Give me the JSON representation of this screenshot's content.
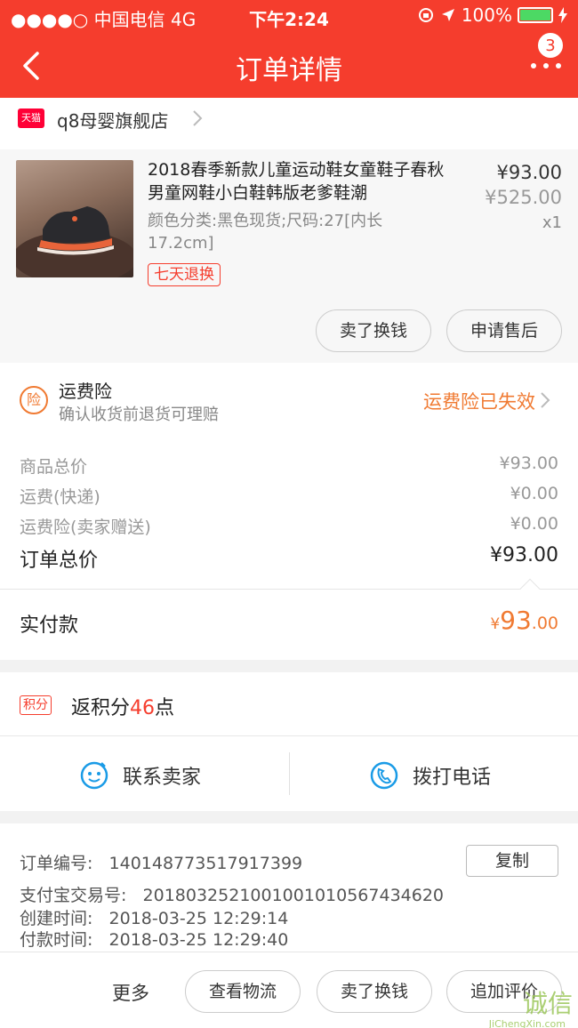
{
  "status_bar": {
    "carrier": "●●●●○ 中国电信  4G",
    "time": "下午2:24",
    "battery": "100%"
  },
  "header": {
    "title": "订单详情",
    "badge_count": "3"
  },
  "shop": {
    "tag": "天猫",
    "name": "q8母婴旗舰店"
  },
  "product": {
    "title": "2018春季新款儿童运动鞋女童鞋子春秋男童网鞋小白鞋韩版老爹鞋潮",
    "spec": "颜色分类:黑色现货;尺码:27[内长17.2cm]",
    "tag": "七天退换",
    "price": "¥93.00",
    "original_price": "¥525.00",
    "quantity": "x1",
    "btn_sell": "卖了换钱",
    "btn_aftersale": "申请售后"
  },
  "insurance": {
    "icon_text": "险",
    "title": "运费险",
    "subtitle": "确认收货前退货可理赔",
    "status": "运费险已失效"
  },
  "summary": {
    "rows": [
      {
        "label": "商品总价",
        "value": "¥93.00"
      },
      {
        "label": "运费(快递)",
        "value": "¥0.00"
      },
      {
        "label": "运费险(卖家赠送)",
        "value": "¥0.00"
      }
    ],
    "total_label": "订单总价",
    "total_value": "¥93.00",
    "paid_label": "实付款",
    "paid_currency": "¥",
    "paid_int": "93",
    "paid_dec": ".00"
  },
  "points": {
    "badge": "积分",
    "prefix": "返积分",
    "number": "46",
    "suffix": "点"
  },
  "contact": {
    "seller": "联系卖家",
    "phone": "拨打电话"
  },
  "order_info": {
    "order_no_label": "订单编号:",
    "order_no": "140148773517917399",
    "copy": "复制",
    "alipay_label": "支付宝交易号:",
    "alipay_no": "2018032521001001010567434620",
    "created_label": "创建时间:",
    "created": "2018-03-25 12:29:14",
    "paid_label": "付款时间:",
    "paid": "2018-03-25 12:29:40"
  },
  "bottom_bar": {
    "more": "更多",
    "logistics": "查看物流",
    "sell": "卖了换钱",
    "review": "追加评价"
  },
  "watermark": {
    "text": "诚信",
    "sub": "JiChengXin.com"
  },
  "colors": {
    "header": "#f53d2d",
    "accent_orange": "#f07a32",
    "tmall": "#ff0036"
  }
}
